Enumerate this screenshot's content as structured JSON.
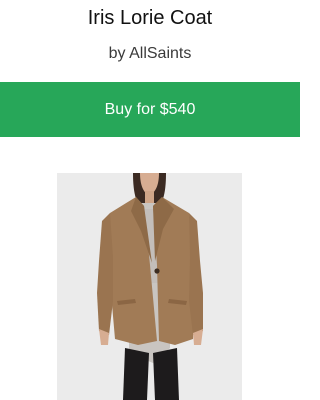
{
  "product": {
    "name": "Iris Lorie Coat",
    "brand_line": "by AllSaints",
    "buy_label": "Buy for $540",
    "image_alt": "Iris Lorie Coat"
  },
  "colors": {
    "accent": "#27a759",
    "button_text": "#ffffff",
    "image_bg": "#ebebeb",
    "coat": "#a17b56"
  }
}
